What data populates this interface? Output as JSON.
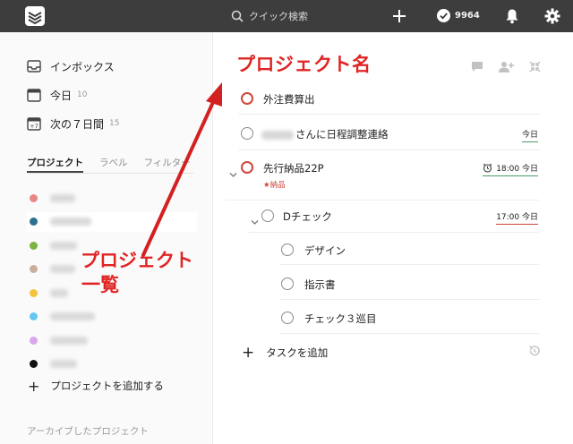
{
  "topbar": {
    "search_placeholder": "クイック検索",
    "karma_count": "9964"
  },
  "sidebar": {
    "nav": [
      {
        "label": "インボックス",
        "count": ""
      },
      {
        "label": "今日",
        "count": "10"
      },
      {
        "label": "次の７日間",
        "count": "15"
      }
    ],
    "calendar_next7_badge": "+7",
    "tabs": [
      "プロジェクト",
      "ラベル",
      "フィルター"
    ],
    "project_colors": [
      "#e88787",
      "#2f6f8f",
      "#7cb342",
      "#c9ae9b",
      "#f5c23e",
      "#63c7f2",
      "#d9a8ec",
      "#111111"
    ],
    "add_project": "プロジェクトを追加する",
    "archived": "アーカイブしたプロジェクト"
  },
  "main": {
    "project_name": "プロジェクト名",
    "tasks": [
      {
        "text": "外注費算出",
        "due": ""
      },
      {
        "text": "さんに日程調整連絡",
        "due": "今日"
      },
      {
        "text": "先行納品22P",
        "due": "18:00 今日",
        "label": "★納品"
      },
      {
        "text": "Dチェック",
        "due": "17:00 今日"
      },
      {
        "text": "デザイン",
        "due": ""
      },
      {
        "text": "指示書",
        "due": ""
      },
      {
        "text": "チェック３巡目",
        "due": ""
      }
    ],
    "add_task": "タスクを追加"
  },
  "annotation": {
    "line1": "プロジェクト",
    "line2": "一覧",
    "color": "#e02424"
  }
}
